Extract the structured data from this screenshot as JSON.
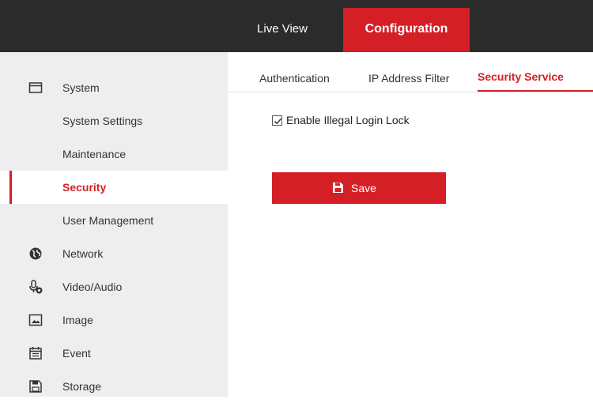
{
  "top_nav": {
    "live_view": "Live View",
    "configuration": "Configuration"
  },
  "sidebar": {
    "items": [
      {
        "label": "System",
        "icon": "monitor-icon"
      },
      {
        "label": "System Settings"
      },
      {
        "label": "Maintenance"
      },
      {
        "label": "Security",
        "active": true
      },
      {
        "label": "User Management"
      },
      {
        "label": "Network",
        "icon": "globe-icon"
      },
      {
        "label": "Video/Audio",
        "icon": "microphone-icon"
      },
      {
        "label": "Image",
        "icon": "image-icon"
      },
      {
        "label": "Event",
        "icon": "calendar-icon"
      },
      {
        "label": "Storage",
        "icon": "floppy-icon"
      }
    ]
  },
  "tabs": {
    "authentication": "Authentication",
    "ip_address_filter": "IP Address Filter",
    "security_service": "Security Service"
  },
  "form": {
    "illegal_login_lock_label": "Enable Illegal Login Lock",
    "illegal_login_lock_checked": true,
    "save_label": "Save"
  },
  "colors": {
    "accent": "#d41f26",
    "topbar": "#2b2b2b",
    "sidebar": "#eeeeee"
  }
}
